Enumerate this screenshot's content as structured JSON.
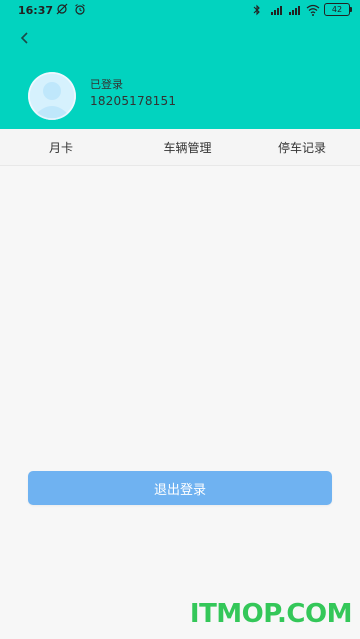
{
  "status_bar": {
    "time": "16:37",
    "battery": "42"
  },
  "header": {
    "user_status": "已登录",
    "phone": "18205178151"
  },
  "tabs": [
    {
      "label": "月卡"
    },
    {
      "label": "车辆管理"
    },
    {
      "label": "停车记录"
    }
  ],
  "actions": {
    "logout_label": "退出登录"
  },
  "watermark": {
    "text": "ITMOP.COM"
  },
  "colors": {
    "header": "#02d3bf",
    "button": "#6fb2f1"
  }
}
